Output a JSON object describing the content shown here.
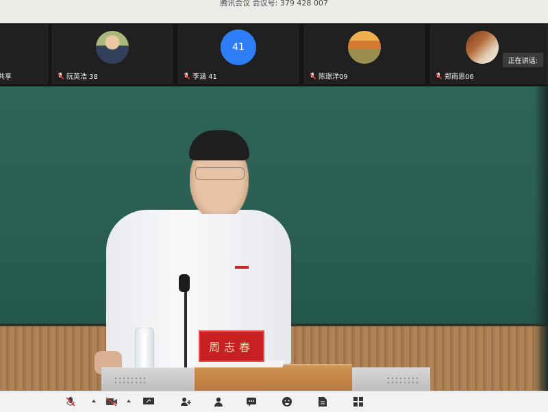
{
  "window": {
    "title": "腾讯会议 会议号: 379 428 007"
  },
  "participants": [
    {
      "name": "共享",
      "avatar": "none",
      "muted": false
    },
    {
      "name": "阮英浩 38",
      "avatar": "photo",
      "muted": true
    },
    {
      "name": "李涵 41",
      "avatar": "number",
      "avatar_text": "41",
      "muted": true
    },
    {
      "name": "陈璟洋09",
      "avatar": "photo",
      "muted": true
    },
    {
      "name": "郑雨思06",
      "avatar": "photo",
      "muted": true
    }
  ],
  "speaking": {
    "label": "正在讲话:"
  },
  "main_video": {
    "nameplate_text": "周志春"
  },
  "toolbar": {
    "items": [
      {
        "icon": "microphone-muted-icon"
      },
      {
        "icon": "video-off-icon"
      },
      {
        "icon": "screen-share-icon"
      },
      {
        "icon": "invite-icon"
      },
      {
        "icon": "members-icon"
      },
      {
        "icon": "chat-icon"
      },
      {
        "icon": "reaction-icon"
      },
      {
        "icon": "document-icon"
      },
      {
        "icon": "apps-icon"
      }
    ]
  },
  "colors": {
    "chalkboard": "#2a5e52",
    "nameplate": "#c81f22",
    "avatar_blue": "#2d7df6"
  }
}
